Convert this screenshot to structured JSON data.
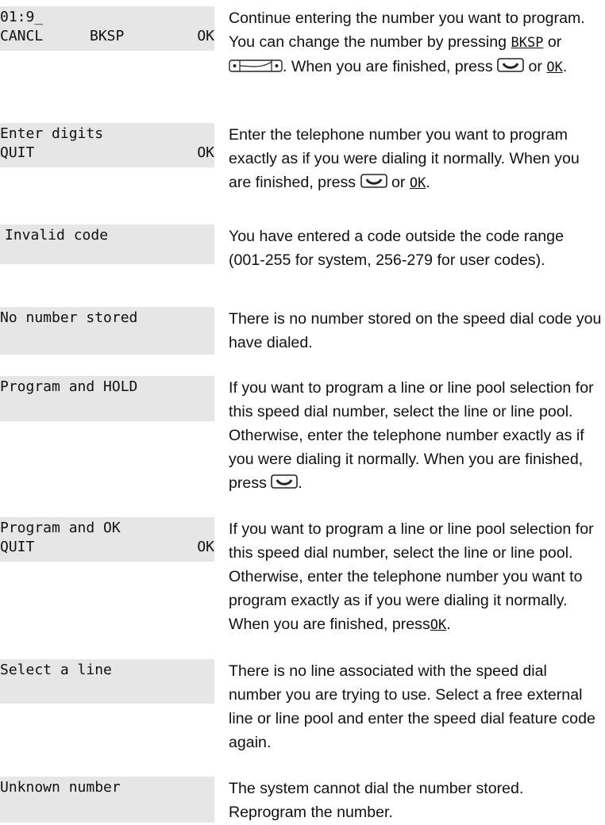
{
  "entries": [
    {
      "display": {
        "line1": "01:9_",
        "line2_left": "CANCL",
        "line2_mid": "BKSP",
        "line2_right": "OK"
      },
      "description": {
        "part1": "Continue entering the number you want to program. You can change the number by pressing ",
        "softkey1": "BKSP",
        "part2": " or ",
        "part3": ". When you are finished, press ",
        "part4": " or ",
        "softkey2": "OK",
        "part5": "."
      }
    },
    {
      "display": {
        "line1": "Enter digits",
        "line2_left": "QUIT",
        "line2_right": "OK"
      },
      "description": {
        "part1": "Enter the telephone number you want to program exactly as if you were dialing it normally. When you are finished, press ",
        "part2": " or ",
        "softkey1": "OK",
        "part3": "."
      }
    },
    {
      "display": {
        "line1": "Invalid code"
      },
      "description": {
        "text": "You have entered a code outside the code range (001-255 for system, 256-279 for user codes)."
      }
    },
    {
      "display": {
        "line1": "No number stored"
      },
      "description": {
        "text": "There is no number stored on the speed dial code you have dialed."
      }
    },
    {
      "display": {
        "line1": "Program and HOLD"
      },
      "description": {
        "part1": "If you want to program a line or line pool selection for this speed dial number, select the line or line pool. Otherwise, enter the telephone number exactly as if you were dialing it normally. When you are finished, press ",
        "part2": "."
      }
    },
    {
      "display": {
        "line1": "Program and OK",
        "line2_left": "QUIT",
        "line2_right": "OK"
      },
      "description": {
        "part1": "If you want to program a line or line pool selection for this speed dial number, select the line or line pool. Otherwise, enter the telephone number you want to program exactly as if you were dialing it normally. When you are finished, press",
        "softkey1": "OK",
        "part2": "."
      }
    },
    {
      "display": {
        "line1": "Select a line"
      },
      "description": {
        "text": "There is no line associated with the speed dial number you are trying to use. Select a free external line or line pool and enter the speed dial feature code again."
      }
    },
    {
      "display": {
        "line1": "Unknown number"
      },
      "description": {
        "text": "The system cannot dial the number stored. Reprogram the number."
      }
    }
  ],
  "icons": {
    "volume_bar": "volume-control-bar-icon",
    "handsfree": "handsfree-button-icon"
  }
}
